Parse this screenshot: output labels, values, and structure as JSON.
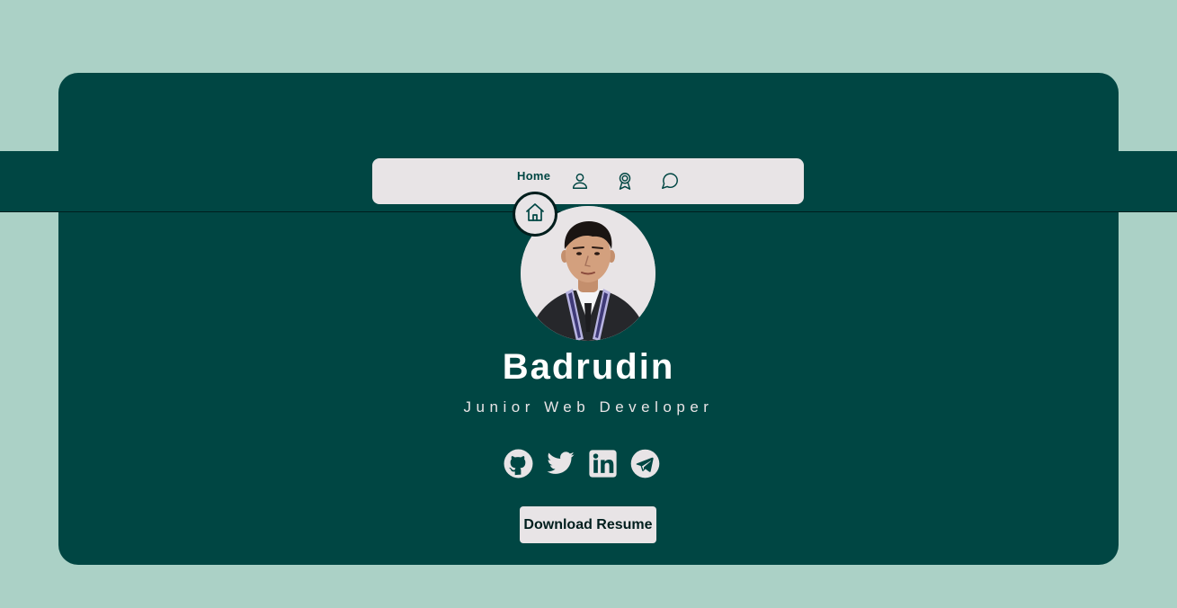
{
  "colors": {
    "page_background": "#abd1c6",
    "card_background": "#004643",
    "nav_background": "#e8e4e6",
    "text_light": "#fffffe",
    "text_dark": "#001e1d"
  },
  "nav": {
    "active_label": "Home",
    "items": [
      {
        "id": "home",
        "icon": "home-icon"
      },
      {
        "id": "about",
        "icon": "user-icon"
      },
      {
        "id": "achievements",
        "icon": "award-icon"
      },
      {
        "id": "contact",
        "icon": "message-circle-icon"
      }
    ]
  },
  "profile": {
    "name": "Badrudin",
    "role": "Junior Web Developer",
    "avatar": "profile-photo"
  },
  "socials": [
    {
      "icon": "github-icon"
    },
    {
      "icon": "twitter-icon"
    },
    {
      "icon": "linkedin-icon"
    },
    {
      "icon": "telegram-icon"
    }
  ],
  "resume_button": {
    "label": "Download Resume"
  }
}
